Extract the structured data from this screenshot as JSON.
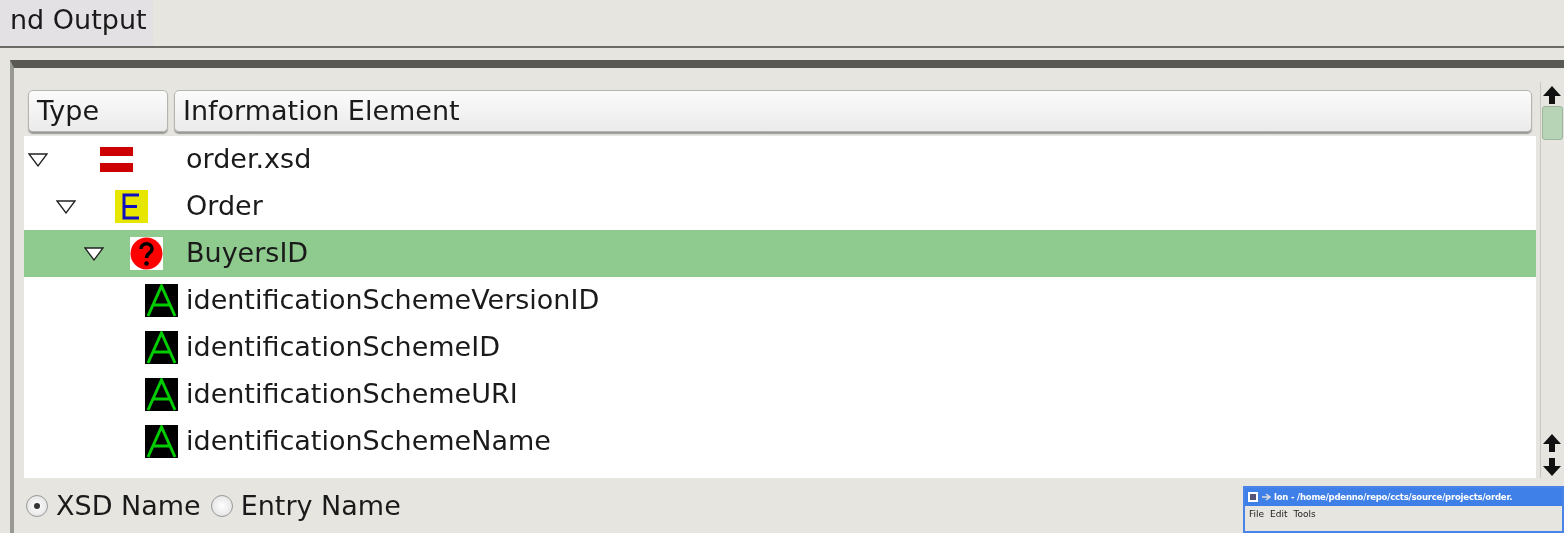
{
  "tabs": [
    {
      "label": "nd Output",
      "selected": true
    }
  ],
  "tree": {
    "columns": [
      "Type",
      "Information Element"
    ],
    "nodes": [
      {
        "label": "order.xsd",
        "kind": "schema",
        "expanded": true,
        "selected": false,
        "children": [
          {
            "label": "Order",
            "kind": "element",
            "expanded": true,
            "selected": false,
            "children": [
              {
                "label": "BuyersID",
                "kind": "choice",
                "expanded": true,
                "selected": true,
                "children": [
                  {
                    "label": "identificationSchemeVersionID",
                    "kind": "attribute",
                    "selected": false
                  },
                  {
                    "label": "identificationSchemeID",
                    "kind": "attribute",
                    "selected": false
                  },
                  {
                    "label": "identificationSchemeURI",
                    "kind": "attribute",
                    "selected": false
                  },
                  {
                    "label": "identificationSchemeName",
                    "kind": "attribute",
                    "selected": false
                  }
                ]
              }
            ]
          }
        ]
      }
    ]
  },
  "name_options": [
    {
      "label": "XSD Name",
      "selected": true
    },
    {
      "label": "Entry Name",
      "selected": false
    }
  ],
  "overlay_window": {
    "title": "lon - /home/pdenno/repo/ccts/source/projects/order.",
    "menu": [
      "File",
      "Edit",
      "Tools"
    ]
  }
}
